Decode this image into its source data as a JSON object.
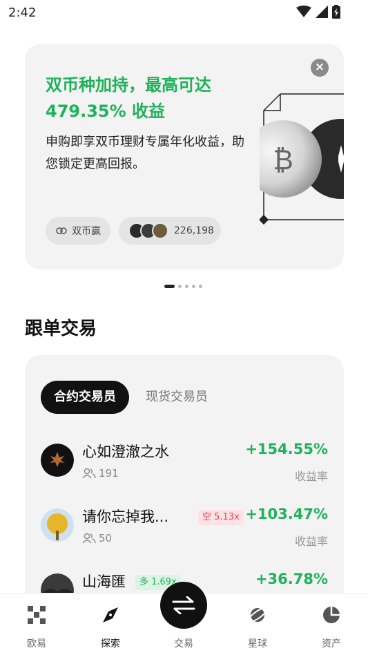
{
  "status_bar": {
    "time": "2:42"
  },
  "banner": {
    "title": "双币种加持，最高可达 479.35% 收益",
    "description": "申购即享双币理财专属年化收益，助您锁定更高回报。",
    "product_tag": "双币赢",
    "participants": "226,198",
    "close_icon": "close-icon",
    "slides_total": 5,
    "slide_active": 1
  },
  "copy_trading": {
    "section_title": "跟单交易",
    "tabs": [
      {
        "label": "合约交易员",
        "active": true
      },
      {
        "label": "现货交易员",
        "active": false
      }
    ],
    "traders": [
      {
        "name": "心如澄澈之水",
        "followers": "191",
        "badge": "",
        "rate": "+154.55%",
        "rate_label": "收益率"
      },
      {
        "name": "请你忘掉我...",
        "followers": "50",
        "badge": "空 5.13x",
        "rate": "+103.47%",
        "rate_label": "收益率"
      },
      {
        "name": "山海匯",
        "followers": "",
        "badge": "多 1.69x",
        "rate": "+36.78%",
        "rate_label": ""
      }
    ],
    "colors": {
      "positive": "#1fb25a",
      "short_badge": "#e8435a"
    }
  },
  "bottom_nav": {
    "items": [
      {
        "label": "欧易",
        "icon": "okx-logo-icon"
      },
      {
        "label": "探索",
        "icon": "compass-icon",
        "active": true
      },
      {
        "label": "交易",
        "icon": "swap-arrows-icon"
      },
      {
        "label": "星球",
        "icon": "planet-icon"
      },
      {
        "label": "资产",
        "icon": "pie-chart-icon"
      }
    ]
  }
}
